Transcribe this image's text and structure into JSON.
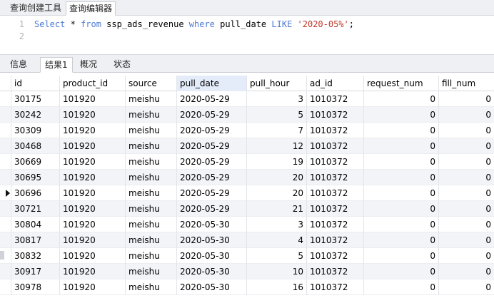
{
  "top_tabs": [
    "查询创建工具",
    "查询编辑器"
  ],
  "editor": {
    "line_numbers": [
      "1",
      "2"
    ],
    "sql_tokens": [
      {
        "t": "Select",
        "c": "kw"
      },
      {
        "t": " * ",
        "c": ""
      },
      {
        "t": "from",
        "c": "kw"
      },
      {
        "t": " ssp_ads_revenue ",
        "c": ""
      },
      {
        "t": "where",
        "c": "kw"
      },
      {
        "t": " pull_date ",
        "c": ""
      },
      {
        "t": "LIKE",
        "c": "kw"
      },
      {
        "t": " ",
        "c": ""
      },
      {
        "t": "'2020-05%'",
        "c": "str"
      },
      {
        "t": ";",
        "c": ""
      }
    ]
  },
  "result_tabs": [
    "信息",
    "结果1",
    "概况",
    "状态"
  ],
  "active_result_tab": 1,
  "columns": [
    {
      "key": "id",
      "label": "id",
      "align": "left"
    },
    {
      "key": "product_id",
      "label": "product_id",
      "align": "left"
    },
    {
      "key": "source",
      "label": "source",
      "align": "left"
    },
    {
      "key": "pull_date",
      "label": "pull_date",
      "align": "left"
    },
    {
      "key": "pull_hour",
      "label": "pull_hour",
      "align": "right"
    },
    {
      "key": "ad_id",
      "label": "ad_id",
      "align": "left"
    },
    {
      "key": "request_num",
      "label": "request_num",
      "align": "right"
    },
    {
      "key": "fill_num",
      "label": "fill_num",
      "align": "right"
    }
  ],
  "sorted_column": "pull_date",
  "current_row": 6,
  "rows": [
    [
      "30175",
      "101920",
      "meishu",
      "2020-05-29",
      "3",
      "1010372",
      "0",
      "0"
    ],
    [
      "30242",
      "101920",
      "meishu",
      "2020-05-29",
      "5",
      "1010372",
      "0",
      "0"
    ],
    [
      "30309",
      "101920",
      "meishu",
      "2020-05-29",
      "7",
      "1010372",
      "0",
      "0"
    ],
    [
      "30468",
      "101920",
      "meishu",
      "2020-05-29",
      "12",
      "1010372",
      "0",
      "0"
    ],
    [
      "30669",
      "101920",
      "meishu",
      "2020-05-29",
      "19",
      "1010372",
      "0",
      "0"
    ],
    [
      "30695",
      "101920",
      "meishu",
      "2020-05-29",
      "20",
      "1010372",
      "0",
      "0"
    ],
    [
      "30696",
      "101920",
      "meishu",
      "2020-05-29",
      "20",
      "1010372",
      "0",
      "0"
    ],
    [
      "30721",
      "101920",
      "meishu",
      "2020-05-29",
      "21",
      "1010372",
      "0",
      "0"
    ],
    [
      "30804",
      "101920",
      "meishu",
      "2020-05-30",
      "3",
      "1010372",
      "0",
      "0"
    ],
    [
      "30817",
      "101920",
      "meishu",
      "2020-05-30",
      "4",
      "1010372",
      "0",
      "0"
    ],
    [
      "30832",
      "101920",
      "meishu",
      "2020-05-30",
      "5",
      "1010372",
      "0",
      "0"
    ],
    [
      "30917",
      "101920",
      "meishu",
      "2020-05-30",
      "10",
      "1010372",
      "0",
      "0"
    ],
    [
      "30978",
      "101920",
      "meishu",
      "2020-05-30",
      "16",
      "1010372",
      "0",
      "0"
    ]
  ]
}
